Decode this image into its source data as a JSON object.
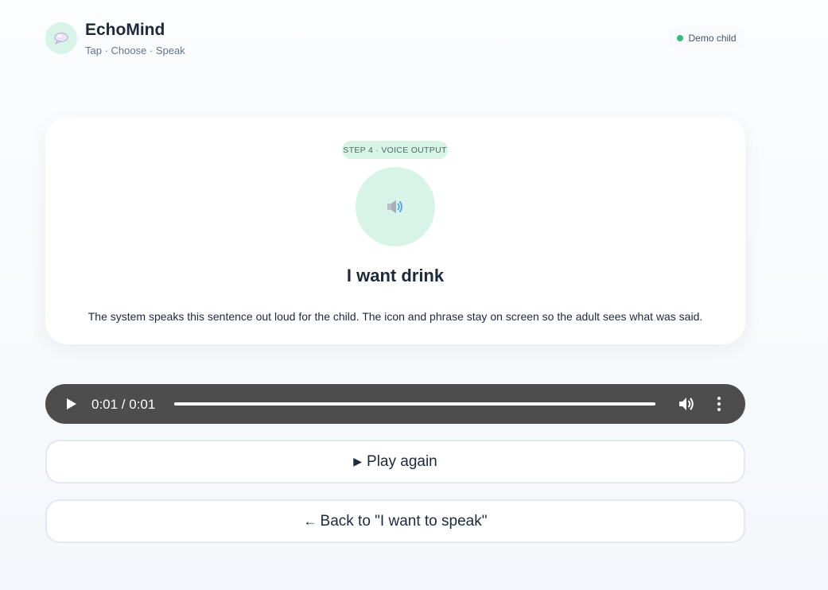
{
  "app": {
    "name": "EchoMind",
    "tagline": "Tap · Choose · Speak",
    "logo_icon": "speech-bubble-icon"
  },
  "profile": {
    "label": "Demo child",
    "status_color": "#34c07c"
  },
  "card": {
    "step_label": "STEP 4 · VOICE OUTPUT",
    "icon": "speaker-icon",
    "phrase": "I want drink",
    "description": "The system speaks this sentence out loud for the child. The icon and phrase stay on screen so the adult sees what was said."
  },
  "audio_player": {
    "time_display": "0:01 / 0:01",
    "progress": 1.0
  },
  "actions": {
    "play_again_glyph": "▶",
    "play_again_label": "Play again",
    "back_glyph": "←",
    "back_label": "Back to \"I want to speak\""
  },
  "colors": {
    "accent_mint": "#d8f3e8",
    "player_bg": "#4d4d4d",
    "text_dark": "#1e293b"
  }
}
